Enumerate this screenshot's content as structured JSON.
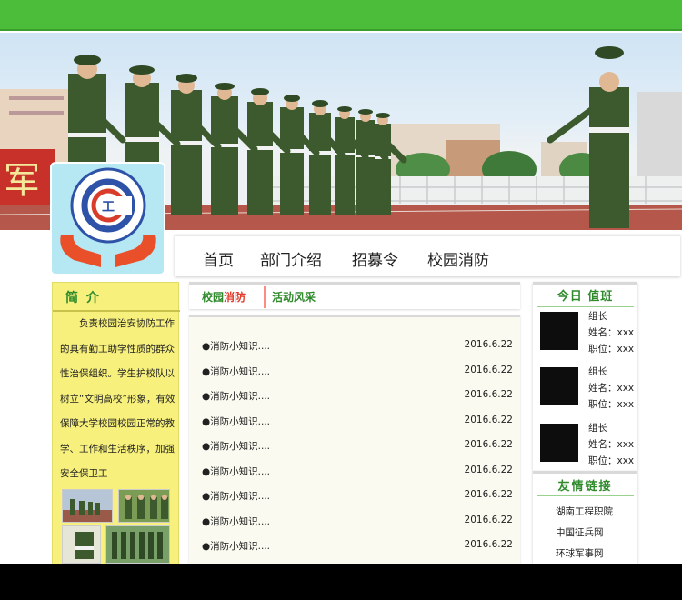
{
  "colors": {
    "header_green": "#4bbd3a",
    "title_green": "#2e8a2b",
    "accent_red": "#e23c2c",
    "intro_yellow": "#f7f07c",
    "footer": "#000000"
  },
  "nav": {
    "items": [
      "首页",
      "部门介绍",
      "招募令",
      "校园消防"
    ]
  },
  "intro": {
    "title": "简 介",
    "text": "负责校园治安协防工作的具有勤工助学性质的群众性治保组织。学生护校队以树立“文明高校”形象，有效保障大学校园校园正常的教学、工作和生活秩序，加强安全保卫工"
  },
  "tabs": {
    "tab1_part1": "校园",
    "tab1_part2": "消防",
    "tab2": "活动风采"
  },
  "news": [
    {
      "title": "●消防小知识....",
      "date": "2016.6.22"
    },
    {
      "title": "●消防小知识....",
      "date": "2016.6.22"
    },
    {
      "title": "●消防小知识....",
      "date": "2016.6.22"
    },
    {
      "title": "●消防小知识....",
      "date": "2016.6.22"
    },
    {
      "title": "●消防小知识....",
      "date": "2016.6.22"
    },
    {
      "title": "●消防小知识....",
      "date": "2016.6.22"
    },
    {
      "title": "●消防小知识....",
      "date": "2016.6.22"
    },
    {
      "title": "●消防小知识....",
      "date": "2016.6.22"
    },
    {
      "title": "●消防小知识....",
      "date": "2016.6.22"
    }
  ],
  "duty": {
    "title": "今日 值班",
    "staff": [
      {
        "role": "组长",
        "name": "姓名：xxx",
        "position": "职位：xxx"
      },
      {
        "role": "组长",
        "name": "姓名：xxx",
        "position": "职位：xxx"
      },
      {
        "role": "组长",
        "name": "姓名：xxx",
        "position": "职位：xxx"
      }
    ]
  },
  "links": {
    "title": "友情链接",
    "items": [
      "湖南工程职院",
      "中国征兵网",
      "环球军事网"
    ]
  },
  "banner": {
    "sign_text": "军"
  },
  "logo": {
    "center_text": "工"
  }
}
